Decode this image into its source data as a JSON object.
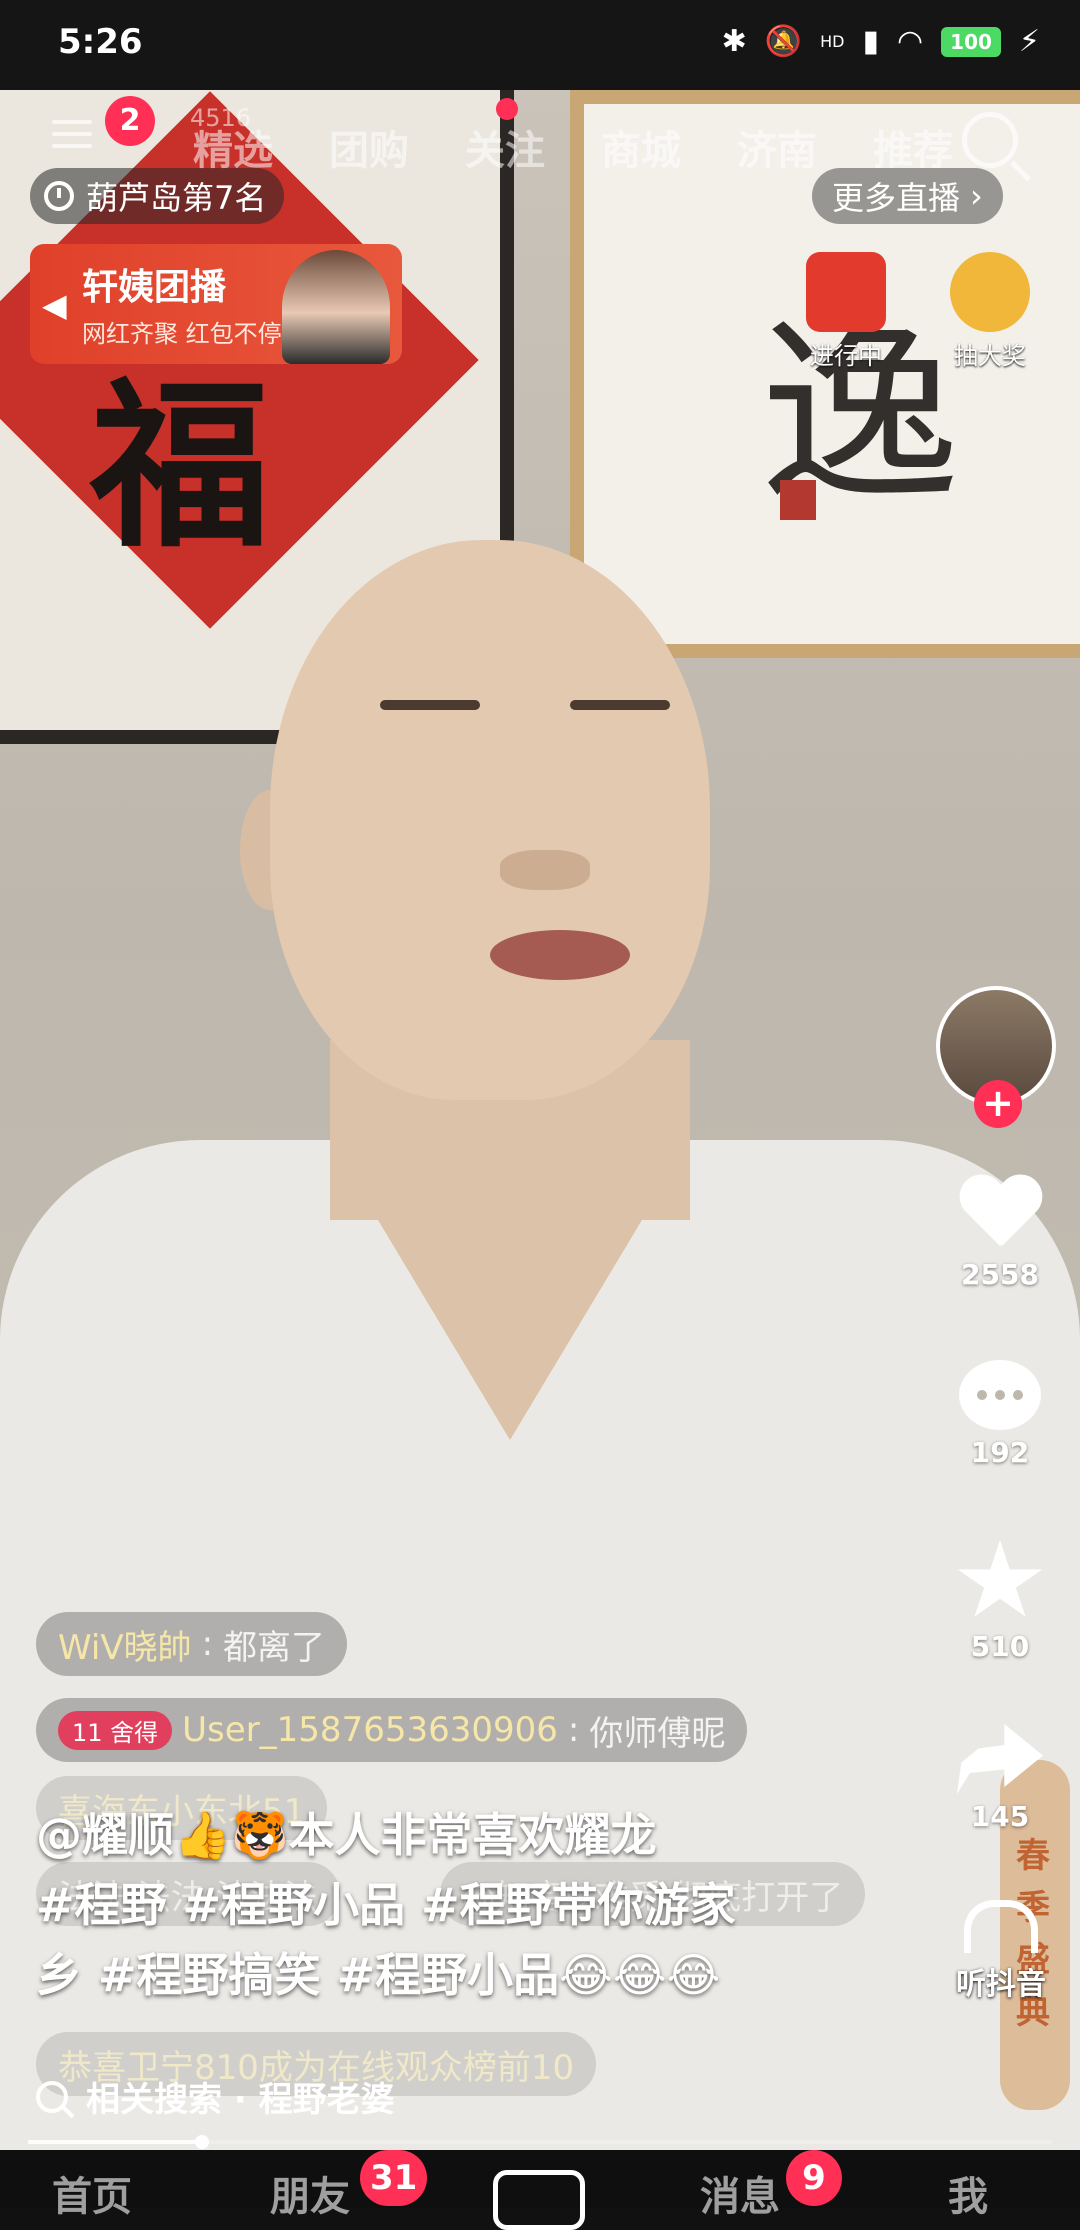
{
  "status_bar": {
    "time": "5:26",
    "network": "HD",
    "battery": "100"
  },
  "top_nav": {
    "notification_count": "2",
    "viewers": "4516",
    "tabs": [
      "精选",
      "团购",
      "关注",
      "商城",
      "济南",
      "推荐"
    ]
  },
  "live": {
    "rank": "葫芦岛第7名",
    "promo_title": "轩姨团播",
    "promo_subtitle": "网红齐聚 红包不停",
    "more_live": "更多直播",
    "in_progress_label": "进行中",
    "lottery_label": "抽大奖"
  },
  "rail": {
    "likes": "2558",
    "comments": "192",
    "favorites": "510",
    "shares": "145",
    "listen_label": "听抖音",
    "festival_text": "春季盛典"
  },
  "chat": [
    {
      "name": "WiV晓帥",
      "text": "都离了"
    },
    {
      "badge": "11 舍得",
      "name": "User_1587653630906",
      "text": "你师傅昵"
    },
    {
      "text": "喜海东小东北51"
    },
    {
      "text": "法法  法法  法法法"
    },
    {
      "text": "@知音♡难觅 彻底打开了"
    },
    {
      "text": "恭喜卫宁810成为在线观众榜前10"
    }
  ],
  "caption": {
    "line1": "@耀顺👍🐯本人非常喜欢耀龙",
    "line2": "#程野 #程野小品 #程野带你游家",
    "line3": "乡 #程野搞笑 #程野小品😂😂😂"
  },
  "related_search": "相关搜索 · 程野老婆",
  "progress": {
    "fraction": 0.17
  },
  "bottom_nav": {
    "home": "首页",
    "friends": "朋友",
    "friends_badge": "31",
    "messages": "消息",
    "messages_badge": "9",
    "me": "我"
  },
  "colors": {
    "accent": "#ff2f55",
    "promo": "#e0402a"
  }
}
